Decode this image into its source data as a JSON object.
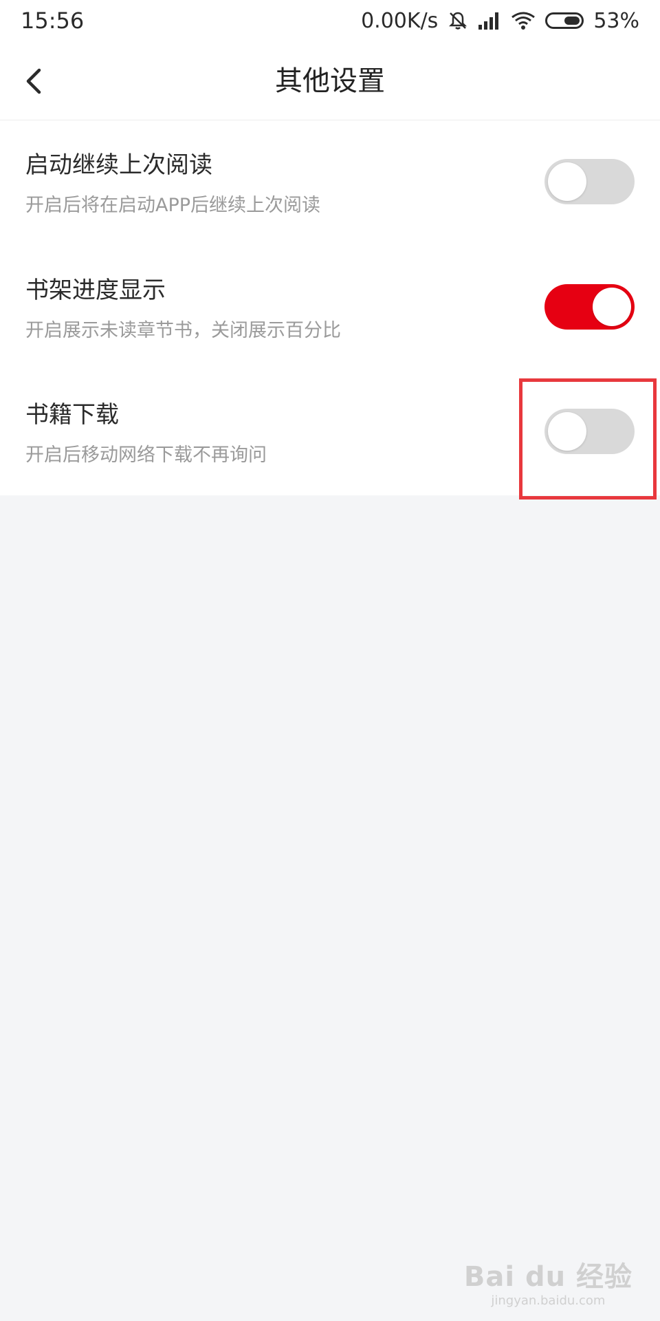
{
  "status_bar": {
    "time": "15:56",
    "network_speed": "0.00K/s",
    "battery_percent": "53%",
    "battery_level": 0.53,
    "icons": [
      "mute-bell-icon",
      "signal-icon",
      "wifi-icon",
      "battery-icon"
    ]
  },
  "nav": {
    "title": "其他设置",
    "back_icon": "chevron-left-icon"
  },
  "settings": [
    {
      "title": "启动继续上次阅读",
      "description": "开启后将在启动APP后继续上次阅读",
      "enabled": false
    },
    {
      "title": "书架进度显示",
      "description": "开启展示未读章节书，关闭展示百分比",
      "enabled": true
    },
    {
      "title": "书籍下载",
      "description": "开启后移动网络下载不再询问",
      "enabled": false
    }
  ],
  "colors": {
    "accent": "#e60012",
    "toggle_off": "#d9d9d9",
    "highlight": "#e8383d",
    "page_bg": "#f4f5f7"
  },
  "watermark": {
    "main": "Bai du 经验",
    "sub": "jingyan.baidu.com"
  }
}
